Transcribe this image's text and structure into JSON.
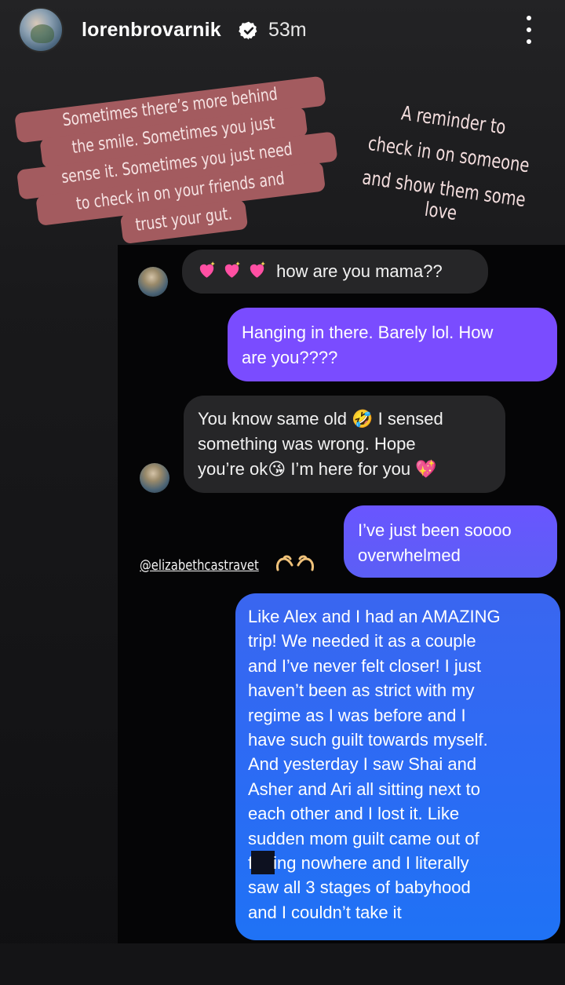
{
  "header": {
    "username": "lorenbrovarnik",
    "time_ago": "53m",
    "verified": true
  },
  "captions": {
    "main_lines": [
      "Sometimes there’s more behind",
      "the smile. Sometimes you just",
      "sense it. Sometimes you just need",
      "to check in on your friends and",
      "trust your gut."
    ],
    "reminder_lines": [
      "A reminder to",
      "check in on someone",
      "and show them some love"
    ]
  },
  "messages": [
    {
      "from": "them",
      "text": "how are you mama??",
      "emoji": "sparkling-hearts"
    },
    {
      "from": "me",
      "lines": [
        "Hanging in there. Barely lol. How",
        "are you????"
      ]
    },
    {
      "from": "them",
      "lines": [
        "You know same old 🤣 I sensed",
        "something was wrong. Hope",
        "you’re ok😘 I’m here for you 💖"
      ]
    },
    {
      "from": "me",
      "lines": [
        "I’ve just been soooo",
        "overwhelmed"
      ]
    },
    {
      "from": "me",
      "lines": [
        "Like Alex and I had an AMAZING",
        "trip! We needed it as a couple",
        "and I’ve never felt closer! I just",
        "haven’t been as strict with my",
        "regime as I was before and I",
        "have such guilt towards myself.",
        "And yesterday I saw Shai and",
        "Asher and Ari all sitting next to",
        "each other and I lost it. Like",
        "sudden mom guilt came out of",
        "f",
        "ing nowhere and I literally",
        "saw all 3 stages of babyhood",
        "and I couldn’t take it"
      ]
    }
  ],
  "mention": "@elizabethcastravet",
  "colors": {
    "caption_bg": "#a35b5f",
    "incoming_bubble": "#262628",
    "outgoing_purple": "#7b4dff",
    "outgoing_blue": "#2f6cf2"
  }
}
